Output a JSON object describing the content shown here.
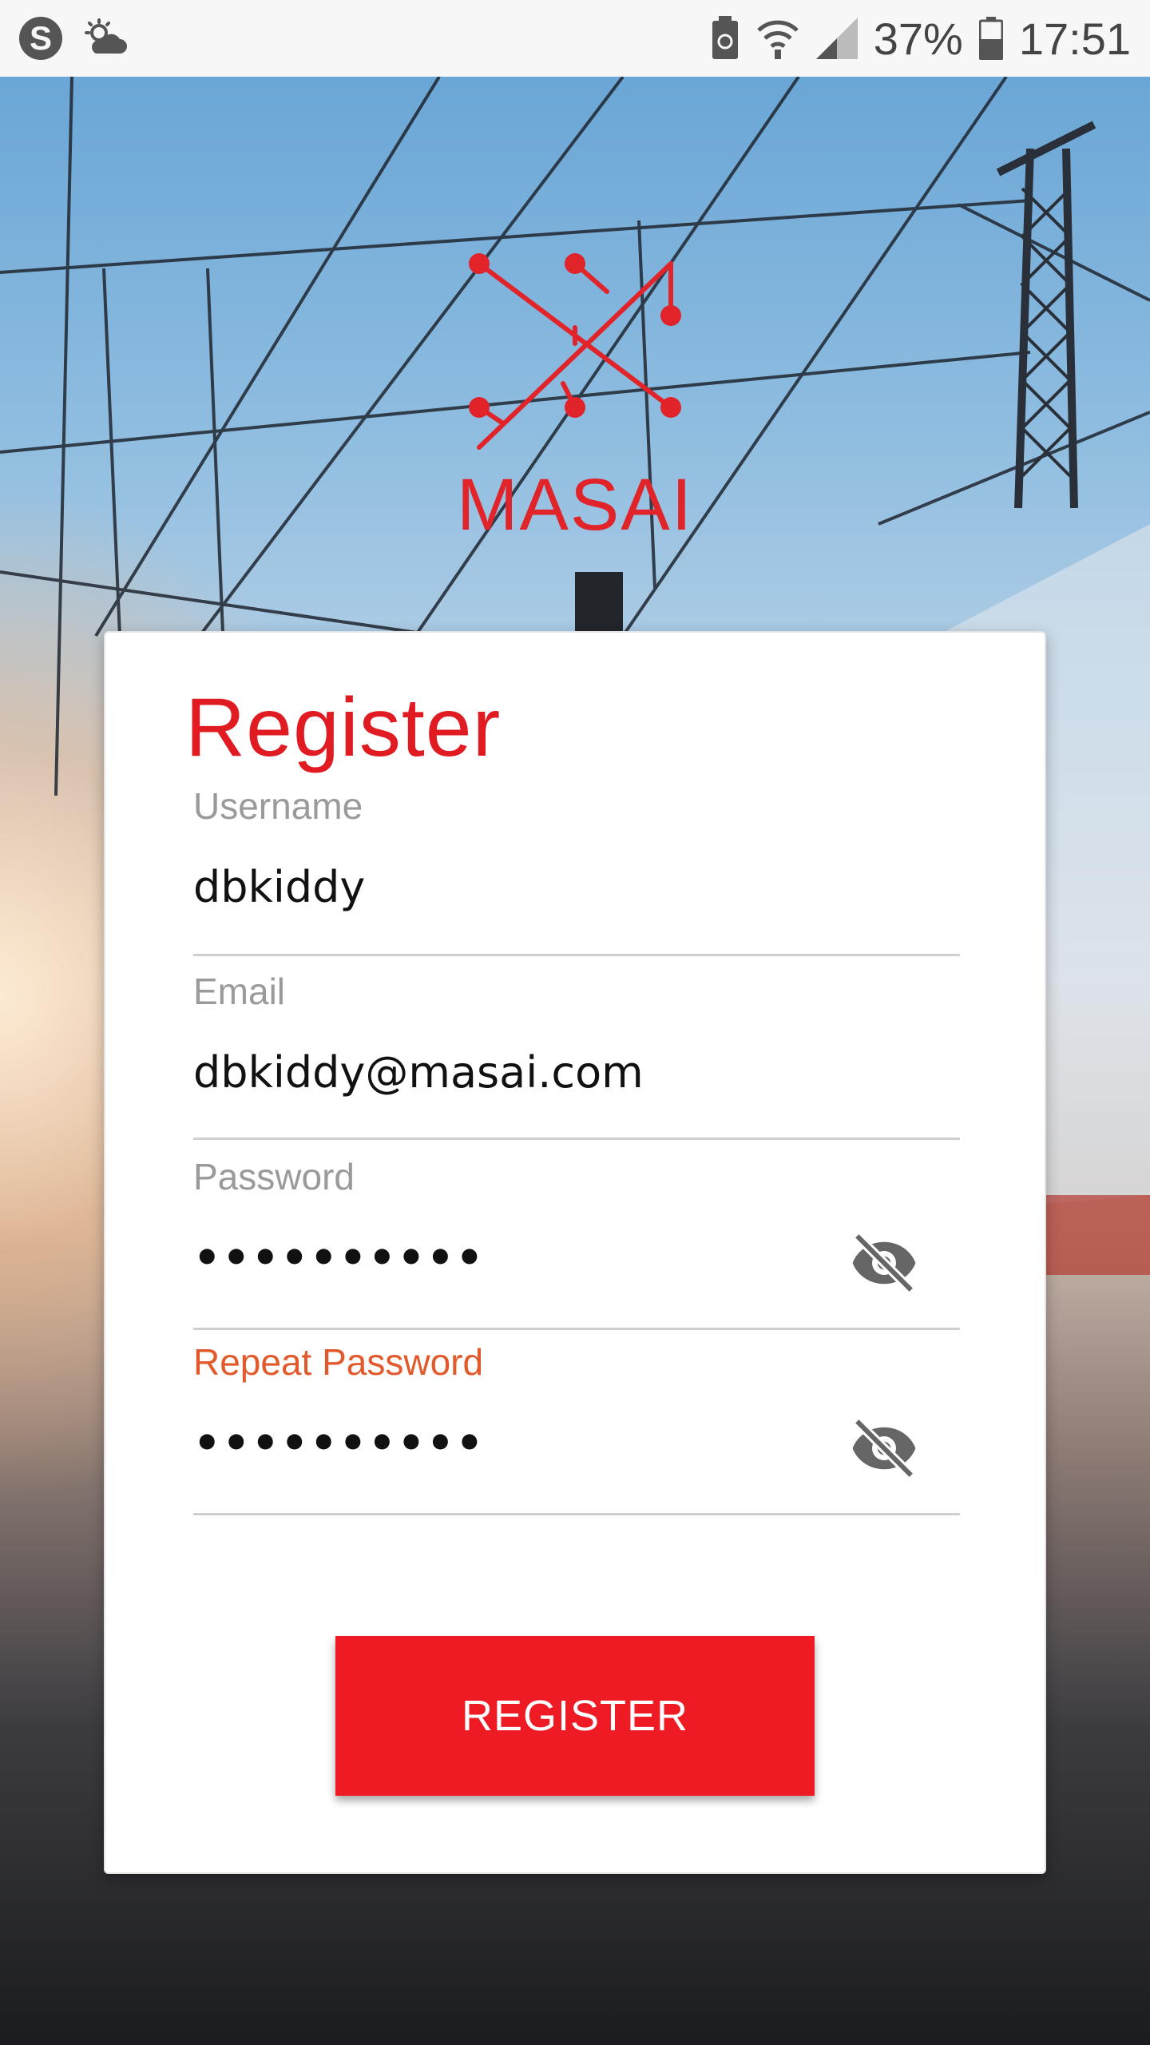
{
  "status_bar": {
    "battery_percent": "37%",
    "time": "17:51",
    "icons": [
      "skype-icon",
      "weather-icon",
      "battery-saver-icon",
      "wifi-icon",
      "signal-icon",
      "battery-icon"
    ]
  },
  "logo": {
    "text": "MASAI",
    "color": "#e0242a"
  },
  "form": {
    "title": "Register",
    "fields": [
      {
        "label": "Username",
        "value": "dbkiddy"
      },
      {
        "label": "Email",
        "value": "dbkiddy@masai.com"
      },
      {
        "label": "Password",
        "value": "••••••••••",
        "toggle_icon": "visibility-off-icon"
      },
      {
        "label": "Repeat Password",
        "value": "••••••••••",
        "toggle_icon": "visibility-off-icon",
        "focused": true
      }
    ],
    "submit_label": "REGISTER"
  },
  "colors": {
    "accent": "#ee1b24",
    "focus_label": "#e2592b"
  }
}
